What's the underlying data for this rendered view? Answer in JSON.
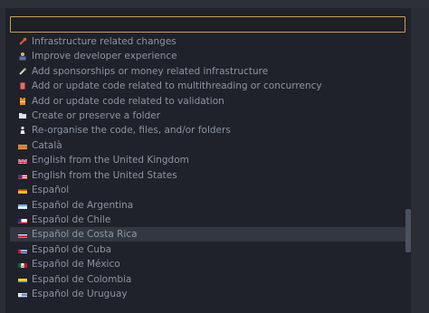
{
  "search": {
    "value": "",
    "placeholder": ""
  },
  "items": [
    {
      "label": "Infrastructure related changes",
      "icon": "wrench-icon"
    },
    {
      "label": "Improve developer experience",
      "icon": "technologist-icon"
    },
    {
      "label": "Add sponsorships or money related infrastructure",
      "icon": "money-icon"
    },
    {
      "label": "Add or update code related to multithreading or concurrency",
      "icon": "thread-icon"
    },
    {
      "label": "Add or update code related to validation",
      "icon": "safety-vest-icon"
    },
    {
      "label": "Create or preserve a folder",
      "icon": "folder-icon"
    },
    {
      "label": "Re-organise the code, files, and/or folders",
      "icon": "chess-pawn-icon"
    },
    {
      "label": "Català",
      "icon": "flag-catalonia-icon"
    },
    {
      "label": "English from the United Kingdom",
      "icon": "flag-uk-icon"
    },
    {
      "label": "English from the United States",
      "icon": "flag-us-icon"
    },
    {
      "label": "Español",
      "icon": "flag-spain-icon"
    },
    {
      "label": "Español de Argentina",
      "icon": "flag-argentina-icon"
    },
    {
      "label": "Español de Chile",
      "icon": "flag-chile-icon"
    },
    {
      "label": "Español de Costa Rica",
      "icon": "flag-costa-rica-icon"
    },
    {
      "label": "Español de Cuba",
      "icon": "flag-cuba-icon"
    },
    {
      "label": "Español de México",
      "icon": "flag-mexico-icon"
    },
    {
      "label": "Español de Colombia",
      "icon": "flag-colombia-icon"
    },
    {
      "label": "Español de Uruguay",
      "icon": "flag-uruguay-icon"
    }
  ],
  "selected_index": 13,
  "colors": {
    "accent_border": "#c7a24a",
    "selected_bg": "#323741"
  }
}
